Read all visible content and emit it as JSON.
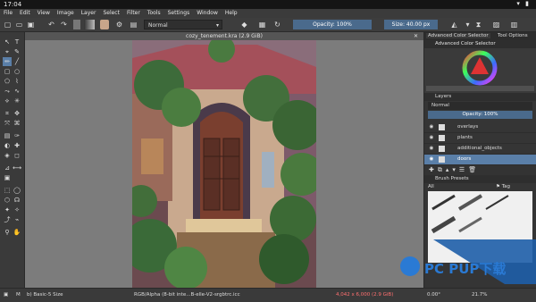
{
  "android_status": {
    "time": "17:04"
  },
  "menu": [
    "File",
    "Edit",
    "View",
    "Image",
    "Layer",
    "Select",
    "Filter",
    "Tools",
    "Settings",
    "Window",
    "Help"
  ],
  "toolbar": {
    "blend_mode": "Normal",
    "opacity": "Opacity: 100%",
    "size": "Size: 40.00 px"
  },
  "document": {
    "tab_title": "cozy_tenement.kra (2.9 GiB)"
  },
  "dockers": {
    "tab_color": "Advanced Color Selector",
    "tab_tool": "Tool Options",
    "color_selector_title": "Advanced Color Selector",
    "layers_title": "Layers",
    "layer_blend": "Normal",
    "layer_opacity": "Opacity: 100%",
    "layers": [
      {
        "name": "overlays"
      },
      {
        "name": "plants"
      },
      {
        "name": "additional_objects"
      },
      {
        "name": "doors"
      }
    ],
    "brush_presets_title": "Brush Presets",
    "brush_filter": "All",
    "brush_tag": "Tag"
  },
  "status": {
    "brush": "b) Basic-5 Size",
    "color_model": "RGB/Alpha (8-bit inte...B-elle-V2-srgbtrc.icc",
    "dimensions": "4,042 x 6,000 (2.9 GiB)",
    "rotation": "0.00°",
    "zoom": "21.7%"
  },
  "watermark": {
    "text": "PC PUP下载"
  }
}
